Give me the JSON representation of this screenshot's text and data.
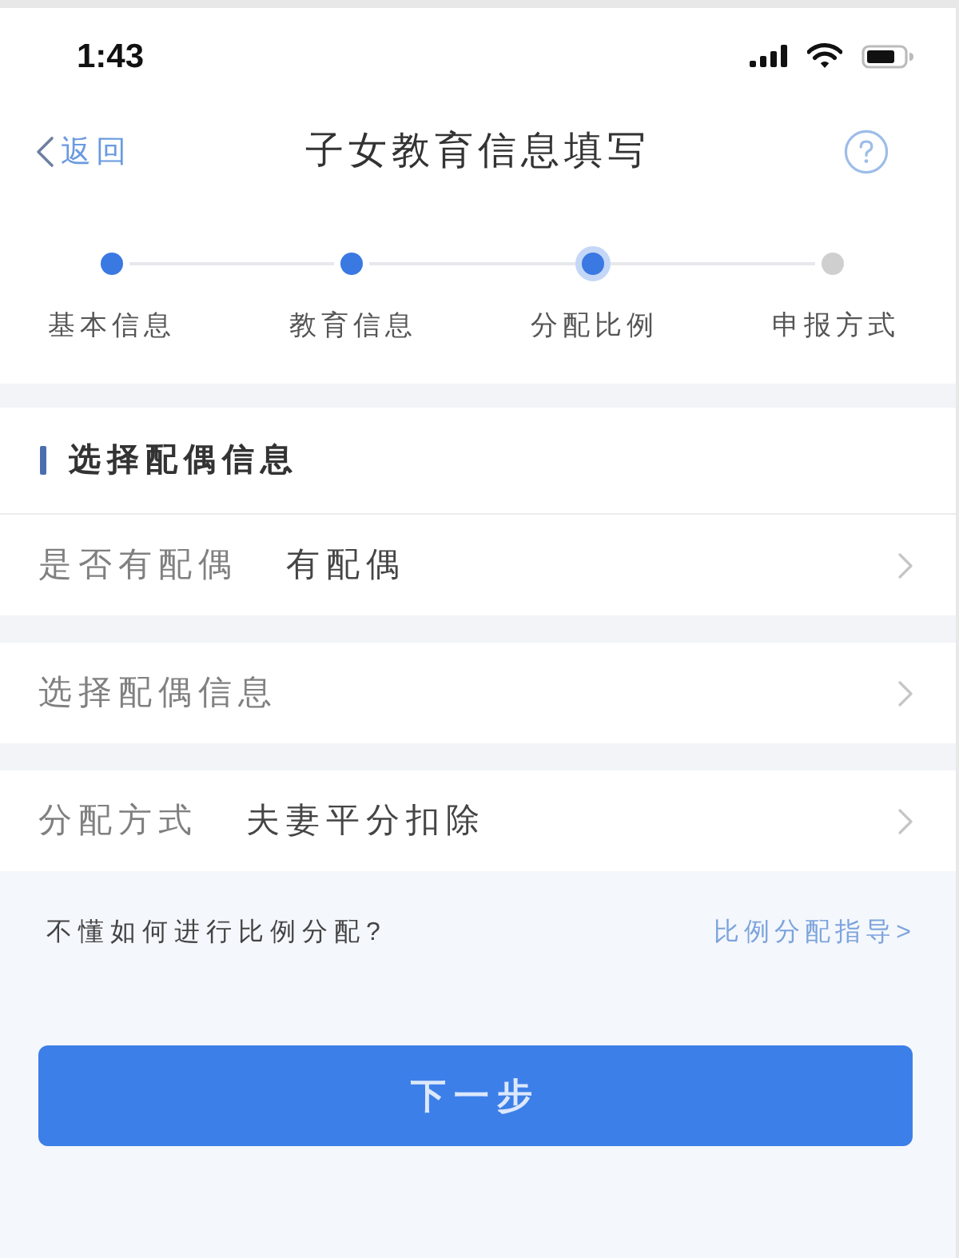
{
  "status_bar": {
    "time": "1:43"
  },
  "nav_bar": {
    "back_label": "返回",
    "title": "子女教育信息填写"
  },
  "steps": [
    {
      "label": "基本信息",
      "reached": true,
      "selected": false
    },
    {
      "label": "教育信息",
      "reached": true,
      "selected": false
    },
    {
      "label": "分配比例",
      "reached": true,
      "selected": true
    },
    {
      "label": "申报方式",
      "reached": false,
      "selected": false
    }
  ],
  "section": {
    "title": "选择配偶信息"
  },
  "rows": [
    {
      "label": "是否有配偶",
      "value": "有配偶"
    },
    {
      "label": "选择配偶信息"
    },
    {
      "label": "分配方式",
      "value": "夫妻平分扣除"
    }
  ],
  "hint": {
    "text": "不懂如何进行比例分配?",
    "link": "比例分配指导>"
  },
  "primary_button": {
    "label": "下一步"
  }
}
